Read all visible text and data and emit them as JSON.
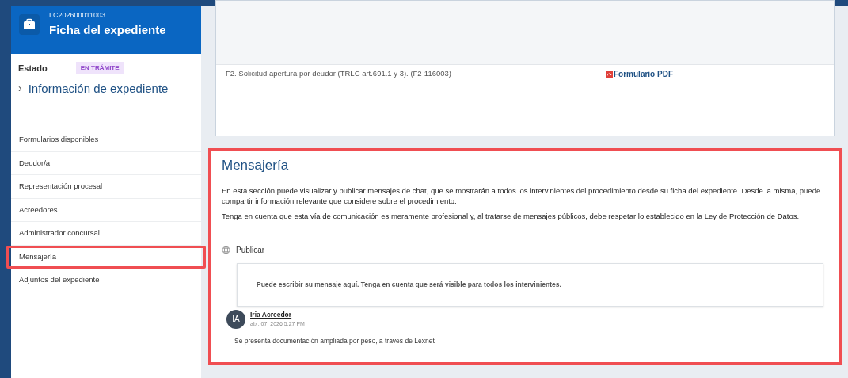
{
  "header": {
    "case_number": "LC202600011003",
    "title": "Ficha del expediente"
  },
  "status": {
    "label": "Estado",
    "badge": "EN TRÁMITE"
  },
  "info_link": {
    "chevron": "›",
    "label": "Información de expediente"
  },
  "nav_items": [
    {
      "label": "Formularios disponibles",
      "highlighted": false
    },
    {
      "label": "Deudor/a",
      "highlighted": false
    },
    {
      "label": "Representación procesal",
      "highlighted": false
    },
    {
      "label": "Acreedores",
      "highlighted": false
    },
    {
      "label": "Administrador concursal",
      "highlighted": false
    },
    {
      "label": "Mensajería",
      "highlighted": true
    },
    {
      "label": "Adjuntos del expediente",
      "highlighted": false
    }
  ],
  "forms_table": {
    "rows": [
      {
        "name": "F2. Solicitud apertura por deudor (TRLC art.691.1 y 3). (F2-116003)",
        "link": "Formulario PDF"
      }
    ]
  },
  "messaging": {
    "highlighted": true,
    "title": "Mensajería",
    "paragraphs": [
      "En esta sección puede visualizar y publicar mensajes de chat, que se mostrarán a todos los intervinientes del procedimiento desde su ficha del expediente. Desde la misma, puede compartir información relevante que considere sobre el procedimiento.",
      "Tenga en cuenta que esta vía de comunicación es meramente profesional y, al tratarse de mensajes públicos, debe respetar lo establecido en la Ley de Protección de Datos."
    ],
    "publish_label": "Publicar",
    "message_placeholder": "Puede escribir su mensaje aquí. Tenga en cuenta que será visible para todos los intervinientes.",
    "messages": [
      {
        "initials": "IA",
        "author": "Iria Acreedor",
        "date": "abr. 07, 2026 5:27 PM",
        "text": "Se presenta documentación ampliada por peso, a traves de Lexnet"
      }
    ]
  }
}
